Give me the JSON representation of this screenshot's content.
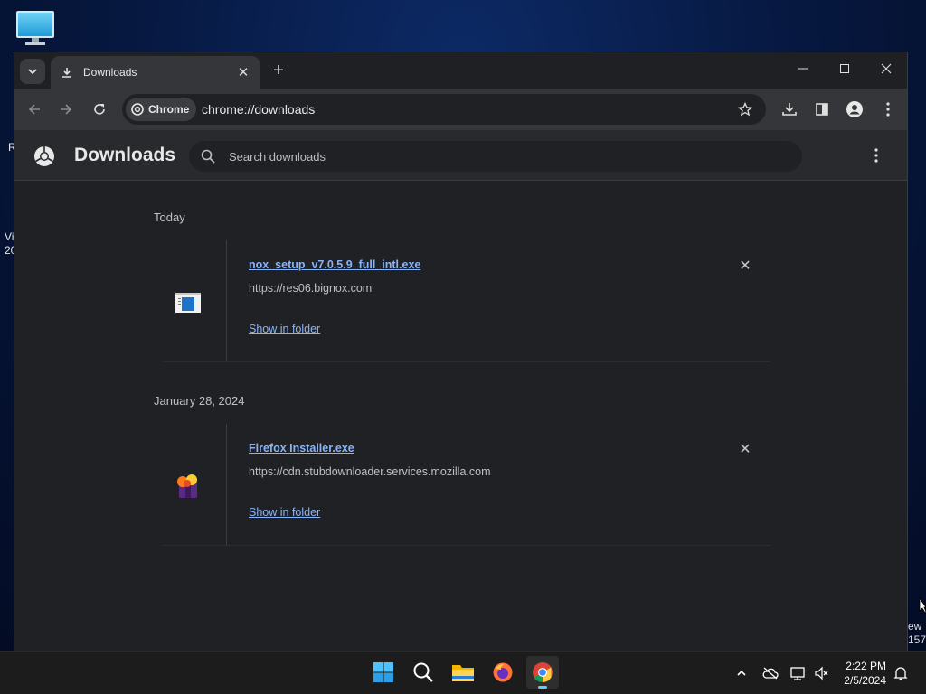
{
  "desktop": {
    "left_fragments": [
      "R",
      "Vi",
      "20"
    ],
    "right_fragments": [
      "ew",
      "157"
    ]
  },
  "tab": {
    "title": "Downloads"
  },
  "toolbar": {
    "chip_label": "Chrome",
    "url": "chrome://downloads"
  },
  "page": {
    "title": "Downloads",
    "search_placeholder": "Search downloads"
  },
  "groups": [
    {
      "date": "Today",
      "items": [
        {
          "filename": "nox_setup_v7.0.5.9_full_intl.exe",
          "url": "https://res06.bignox.com",
          "action": "Show in folder",
          "icon": "installer-file-icon"
        }
      ]
    },
    {
      "date": "January 28, 2024",
      "items": [
        {
          "filename": "Firefox Installer.exe",
          "url": "https://cdn.stubdownloader.services.mozilla.com",
          "action": "Show in folder",
          "icon": "firefox-installer-icon"
        }
      ]
    }
  ],
  "taskbar": {
    "apps": [
      "start-icon",
      "search-icon",
      "file-explorer-icon",
      "firefox-icon",
      "chrome-icon"
    ],
    "time": "2:22 PM",
    "date": "2/5/2024"
  }
}
